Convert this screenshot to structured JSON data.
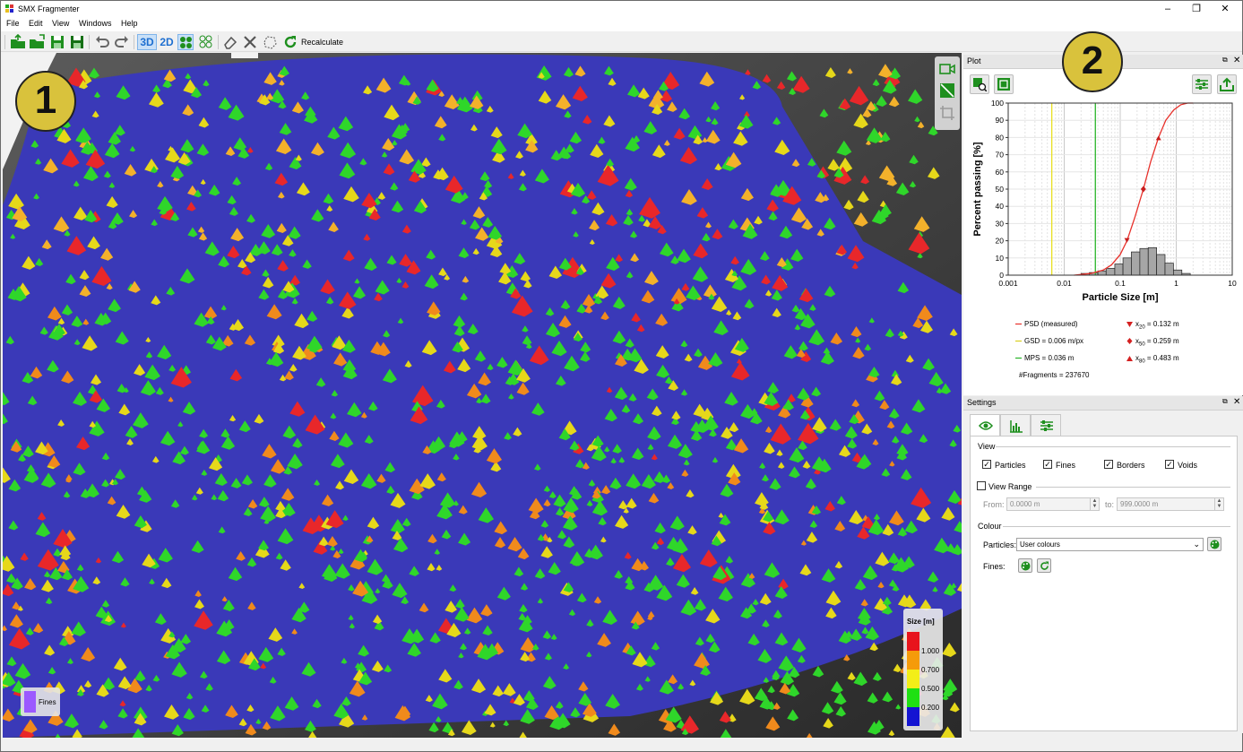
{
  "window": {
    "title": "SMX Fragmenter",
    "controls": [
      "–",
      "❐",
      "✕"
    ]
  },
  "menu": [
    "File",
    "Edit",
    "View",
    "Windows",
    "Help"
  ],
  "toolbar": {
    "view3d_label": "3D",
    "view2d_label": "2D",
    "recalculate_label": "Recalculate"
  },
  "viewport": {
    "badge": "1",
    "legend": {
      "title": "Size [m]",
      "values": [
        "1.000",
        "0.700",
        "0.500",
        "0.200"
      ],
      "colors": [
        "#e8141c",
        "#f59b0a",
        "#f3ee18",
        "#1fe012",
        "#1414d2"
      ]
    },
    "fines_label": "Fines",
    "fines_color": "#9b59ff"
  },
  "plot_panel": {
    "title": "Plot",
    "badge": "2",
    "legend": {
      "psd": "PSD (measured)",
      "gsd": "GSD = 0.006 m/px",
      "mps": "MPS = 0.036 m",
      "fragments": "#Fragments = 237670",
      "x20_sub": "20",
      "x50_sub": "50",
      "x80_sub": "80",
      "x20_val": "= 0.132 m",
      "x50_val": "= 0.259 m",
      "x80_val": "= 0.483 m",
      "x_prefix": "x"
    }
  },
  "chart_data": {
    "type": "line",
    "xlabel": "Particle Size [m]",
    "ylabel": "Percent passing [%]",
    "xscale": "log",
    "xlim": [
      0.001,
      10
    ],
    "ylim": [
      0,
      100
    ],
    "x_ticks": [
      "0.001",
      "0.01",
      "0.1",
      "1",
      "10"
    ],
    "y_ticks": [
      "0",
      "10",
      "20",
      "30",
      "40",
      "50",
      "60",
      "70",
      "80",
      "90",
      "100"
    ],
    "grid": true,
    "series": [
      {
        "name": "PSD (measured)",
        "color": "#e8322c",
        "x": [
          0.015,
          0.03,
          0.05,
          0.07,
          0.1,
          0.132,
          0.18,
          0.259,
          0.35,
          0.483,
          0.65,
          0.9,
          1.2,
          1.6,
          2.0
        ],
        "y": [
          0,
          1,
          3,
          6,
          12,
          20,
          33,
          50,
          66,
          80,
          90,
          96,
          99,
          100,
          100
        ]
      }
    ],
    "vlines": [
      {
        "name": "GSD = 0.006 m/px",
        "x": 0.006,
        "color": "#e8e020"
      },
      {
        "name": "MPS = 0.036 m",
        "x": 0.036,
        "color": "#28b428"
      }
    ],
    "markers": [
      {
        "name": "x20",
        "x": 0.132,
        "y": 20,
        "shape": "triangle-down"
      },
      {
        "name": "x50",
        "x": 0.259,
        "y": 50,
        "shape": "diamond"
      },
      {
        "name": "x80",
        "x": 0.483,
        "y": 80,
        "shape": "triangle-up"
      }
    ],
    "histogram": {
      "bin_edges": [
        0.02,
        0.028,
        0.04,
        0.056,
        0.08,
        0.112,
        0.158,
        0.224,
        0.316,
        0.447,
        0.631,
        0.891,
        1.26,
        1.78
      ],
      "values": [
        1,
        1.5,
        2.5,
        4,
        6.5,
        10,
        13.5,
        15.5,
        16,
        12,
        7,
        3,
        1
      ]
    }
  },
  "settings_panel": {
    "title": "Settings",
    "view_group": "View",
    "checks": [
      {
        "label": "Particles",
        "checked": true
      },
      {
        "label": "Fines",
        "checked": true
      },
      {
        "label": "Borders",
        "checked": true
      },
      {
        "label": "Voids",
        "checked": true
      }
    ],
    "view_range": {
      "label": "View Range",
      "checked": false,
      "from_label": "From:",
      "from_value": "0.0000 m",
      "to_label": "to:",
      "to_value": "999.0000 m"
    },
    "colour_group": "Colour",
    "particles_label": "Particles:",
    "particles_value": "User colours",
    "fines_label": "Fines:"
  }
}
